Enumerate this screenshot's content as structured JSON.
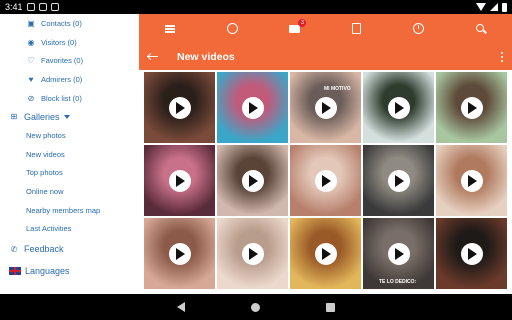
{
  "status_bar": {
    "time": "3:41"
  },
  "sidebar": {
    "items": [
      {
        "label": "Contacts (0)",
        "icon": "contacts-icon",
        "glyph": "▣"
      },
      {
        "label": "Visitors (0)",
        "icon": "eye-icon",
        "glyph": "◉"
      },
      {
        "label": "Favorites (0)",
        "icon": "heart-outline-icon",
        "glyph": "♡"
      },
      {
        "label": "Admirers (0)",
        "icon": "heart-icon",
        "glyph": "♥"
      },
      {
        "label": "Block list (0)",
        "icon": "block-icon",
        "glyph": "⊘"
      }
    ],
    "galleries": {
      "label": "Galleries",
      "icon": "windows-icon",
      "items": [
        "New photos",
        "New videos",
        "Top photos",
        "Online now",
        "Nearby members map",
        "Last Activities"
      ]
    },
    "feedback": {
      "label": "Feedback",
      "icon": "whatsapp-icon"
    },
    "languages": {
      "label": "Languages",
      "icon": "uk-flag-icon"
    }
  },
  "toolbar": {
    "mail_badge": "3",
    "icons": [
      "menu-icon",
      "profile-icon",
      "mail-icon",
      "contacts-card-icon",
      "clock-icon",
      "search-icon"
    ]
  },
  "titlebar": {
    "title": "New videos"
  },
  "grid": {
    "tiles": [
      {
        "colors": [
          "#7a4b3a",
          "#2b1f1a"
        ],
        "caption": ""
      },
      {
        "colors": [
          "#3aa7c9",
          "#c25a7a"
        ],
        "caption": ""
      },
      {
        "colors": [
          "#d9b7a5",
          "#6a5c58"
        ],
        "caption": "MI MOTIVO"
      },
      {
        "colors": [
          "#d5e0de",
          "#2e3c2e"
        ],
        "caption": ""
      },
      {
        "colors": [
          "#a8c7a0",
          "#5e4a3a"
        ],
        "caption": ""
      },
      {
        "colors": [
          "#5a2b3a",
          "#c9718a"
        ],
        "caption": ""
      },
      {
        "colors": [
          "#d0b8ae",
          "#5a4438"
        ],
        "caption": ""
      },
      {
        "colors": [
          "#b77f6c",
          "#e3c7b8"
        ],
        "caption": ""
      },
      {
        "colors": [
          "#3a3a3a",
          "#8f8a82"
        ],
        "caption": ""
      },
      {
        "colors": [
          "#e6d0c0",
          "#b07a5e"
        ],
        "caption": ""
      },
      {
        "colors": [
          "#d7a896",
          "#8b5a48"
        ],
        "caption": ""
      },
      {
        "colors": [
          "#ecd8cc",
          "#b89c8c"
        ],
        "caption": ""
      },
      {
        "colors": [
          "#e2b65a",
          "#9a5a28"
        ],
        "caption": ""
      },
      {
        "colors": [
          "#3e3836",
          "#7a6f68"
        ],
        "caption": "TE LO DEDICO:"
      },
      {
        "colors": [
          "#6a3a2a",
          "#1e1a18"
        ],
        "caption": ""
      }
    ]
  }
}
